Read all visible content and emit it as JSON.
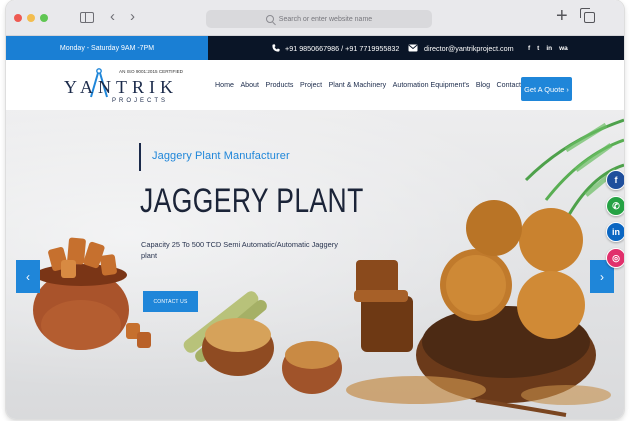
{
  "browser": {
    "address_placeholder": "Search or enter website name",
    "icons": [
      "sidebar-toggle-icon",
      "back-arrow-icon",
      "forward-arrow-icon",
      "search-icon",
      "new-tab-plus-icon",
      "tabs-overview-icon"
    ]
  },
  "topbar": {
    "hours": "Monday - Saturday  9AM -7PM",
    "phones": "+91 9850667986 / +91 7719955832",
    "email": "director@yantrikproject.com",
    "social": [
      "f",
      "t",
      "in",
      "wa"
    ]
  },
  "logo": {
    "cert": "AN ISO 9001:2015 CERTIFIED",
    "brand": "YANTRIK",
    "sub": "PROJECTS"
  },
  "nav": {
    "items": [
      "Home",
      "About",
      "Products",
      "Project",
      "Plant & Machinery",
      "Automation Equipment's",
      "Blog",
      "Contact"
    ],
    "quote_label": "Get A Quote ›"
  },
  "hero": {
    "subtitle": "Jaggery Plant Manufacturer",
    "title": "JAGGERY PLANT",
    "description": "Capacity 25 To 500 TCD Semi Automatic/Automatic Jaggery plant",
    "contact_label": "CONTACT US",
    "prev": "‹",
    "next": "›"
  },
  "float_social": [
    {
      "label": "f",
      "color": "#1f4f9c"
    },
    {
      "label": "✆",
      "color": "#25a244"
    },
    {
      "label": "in",
      "color": "#0a66c2"
    },
    {
      "label": "◎",
      "color": "#e1306c"
    }
  ],
  "colors": {
    "accent": "#1f86d9",
    "dark": "#0a1527",
    "title": "#1b2438"
  }
}
